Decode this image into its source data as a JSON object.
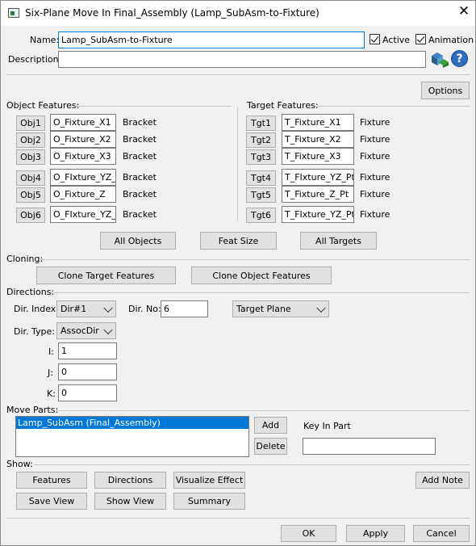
{
  "window": {
    "title": "Six-Plane Move In Final_Assembly (Lamp_SubAsm-to-Fixture)",
    "close_glyph": "✕"
  },
  "header": {
    "name_label": "Name:",
    "name_value": "Lamp_SubAsm-to-Fixture",
    "active_label": "Active",
    "animation_label": "Animation",
    "description_label": "Description:",
    "description_value": ""
  },
  "options_label": "Options",
  "object_features": {
    "title": "Object Features:",
    "rows": [
      {
        "button": "Obj1",
        "value": "O_Fixture_X1",
        "type": "Bracket"
      },
      {
        "button": "Obj2",
        "value": "O_Fixture_X2",
        "type": "Bracket"
      },
      {
        "button": "Obj3",
        "value": "O_Fixture_X3",
        "type": "Bracket"
      },
      {
        "button": "Obj4",
        "value": "O_FIxture_YZ_",
        "type": "Bracket"
      },
      {
        "button": "Obj5",
        "value": "O_Fixture_Z",
        "type": "Bracket"
      },
      {
        "button": "Obj6",
        "value": "O_FIxture_YZ_",
        "type": "Bracket"
      }
    ]
  },
  "target_features": {
    "title": "Target Features:",
    "rows": [
      {
        "button": "Tgt1",
        "value": "T_Fixture_X1",
        "type": "Fixture"
      },
      {
        "button": "Tgt2",
        "value": "T_Fixture_X2",
        "type": "Fixture"
      },
      {
        "button": "Tgt3",
        "value": "T_Fixture_X3",
        "type": "Fixture"
      },
      {
        "button": "Tgt4",
        "value": "T_FIxture_YZ_Pt",
        "type": "Fixture"
      },
      {
        "button": "Tgt5",
        "value": "T_Fixture_Z_Pt",
        "type": "Fixture"
      },
      {
        "button": "Tgt6",
        "value": "T_FIxture_YZ_Pt",
        "type": "Fixture"
      }
    ]
  },
  "feature_buttons": {
    "all_objects": "All Objects",
    "feat_size": "Feat Size",
    "all_targets": "All Targets"
  },
  "cloning": {
    "title": "Cloning:",
    "clone_target": "Clone Target Features",
    "clone_object": "Clone Object Features"
  },
  "directions": {
    "title": "Directions:",
    "dir_index_label": "Dir. Index:",
    "dir_index_value": "Dir#1",
    "dir_no_label": "Dir. No:",
    "dir_no_value": "6",
    "plane_value": "Target Plane",
    "dir_type_label": "Dir. Type:",
    "dir_type_value": "AssocDir",
    "i_label": "I:",
    "i_value": "1",
    "j_label": "J:",
    "j_value": "0",
    "k_label": "K:",
    "k_value": "0"
  },
  "move_parts": {
    "title": "Move Parts:",
    "items": [
      "Lamp_SubAsm (Final_Assembly)"
    ],
    "add_label": "Add",
    "delete_label": "Delete",
    "key_in_label": "Key In Part",
    "key_in_value": ""
  },
  "show": {
    "title": "Show:",
    "features": "Features",
    "directions": "Directions",
    "visualize_effect": "Visualize Effect",
    "add_note": "Add Note",
    "save_view": "Save View",
    "show_view": "Show View",
    "summary": "Summary"
  },
  "footer": {
    "ok": "OK",
    "apply": "Apply",
    "cancel": "Cancel"
  },
  "icons": {
    "help": "?"
  }
}
